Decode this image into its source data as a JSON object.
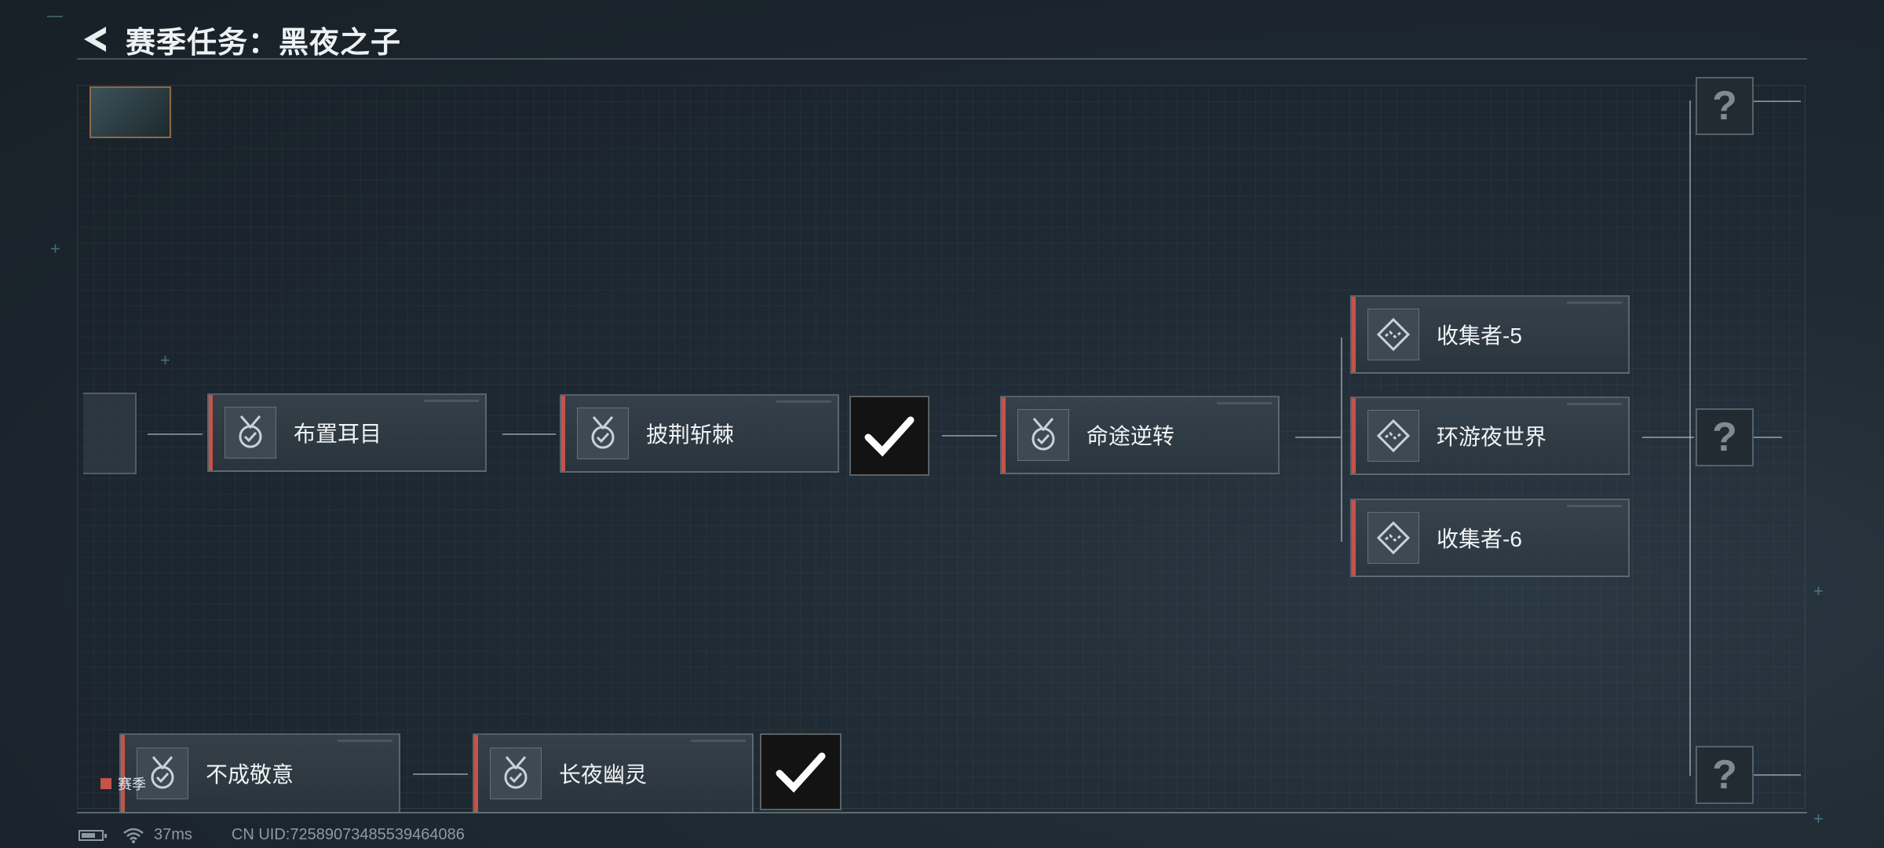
{
  "header": {
    "title": "赛季任务：黑夜之子"
  },
  "main_row": [
    {
      "label": "布置耳目",
      "icon": "medal-check-icon"
    },
    {
      "label": "披荆斩棘",
      "icon": "medal-check-icon"
    },
    {
      "label": "命途逆转",
      "icon": "medal-check-icon"
    }
  ],
  "branch": [
    {
      "label": "收集者-5",
      "icon": "diamond-route-icon"
    },
    {
      "label": "环游夜世界",
      "icon": "diamond-route-icon"
    },
    {
      "label": "收集者-6",
      "icon": "diamond-route-icon"
    }
  ],
  "bottom_row": [
    {
      "label": "不成敬意",
      "icon": "medal-check-icon"
    },
    {
      "label": "长夜幽灵",
      "icon": "medal-check-icon"
    }
  ],
  "locked_label": "?",
  "season_tag": "赛季",
  "status": {
    "ping": "37ms",
    "uid": "CN UID:725890734855394640​86"
  },
  "colors": {
    "accent": "#c4534a",
    "background": "#1f2a33"
  }
}
